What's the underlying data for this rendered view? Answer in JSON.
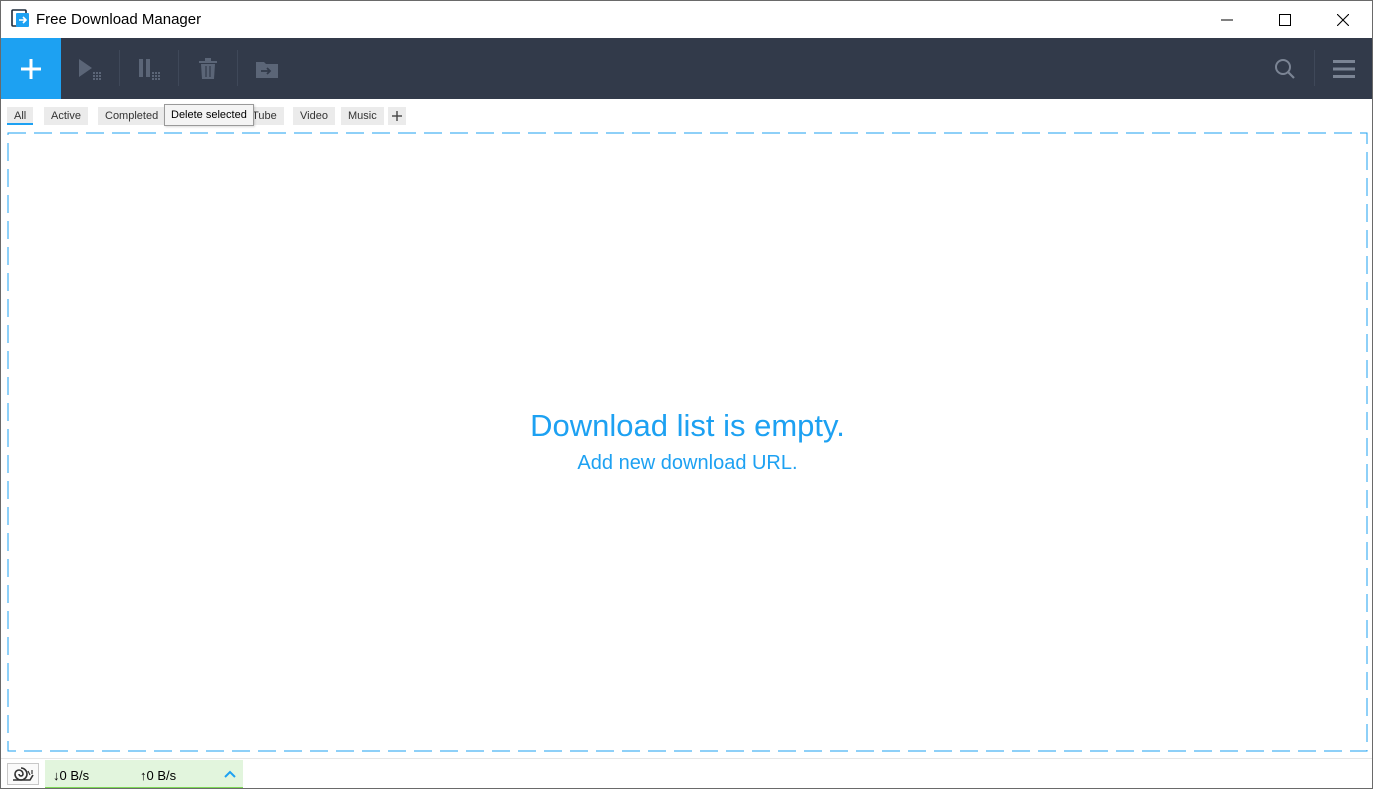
{
  "window": {
    "title": "Free Download Manager"
  },
  "tabs": [
    {
      "label": "All",
      "active": true
    },
    {
      "label": "Active"
    },
    {
      "label": "Completed"
    },
    {
      "label": "YouTube",
      "visible_text": "uTube"
    },
    {
      "label": "Video"
    },
    {
      "label": "Music"
    }
  ],
  "tooltip": {
    "text": "Delete selected"
  },
  "main": {
    "empty_title": "Download list is empty.",
    "empty_subtitle": "Add new download URL."
  },
  "status": {
    "download_speed": "↓0 B/s",
    "upload_speed": "↑0 B/s"
  },
  "colors": {
    "accent": "#1da1f2",
    "toolbar_bg": "#323a4a",
    "speed_panel_bg": "#e2f5dd",
    "speed_panel_bar": "#7ed957"
  },
  "icons": {
    "app": "fdm-logo-icon",
    "add": "plus-icon",
    "start": "play-icon",
    "pause": "pause-icon",
    "delete": "trash-icon",
    "move": "folder-move-icon",
    "search": "search-icon",
    "menu": "hamburger-menu-icon",
    "snail": "snail-icon",
    "expand": "chevron-up-icon"
  }
}
